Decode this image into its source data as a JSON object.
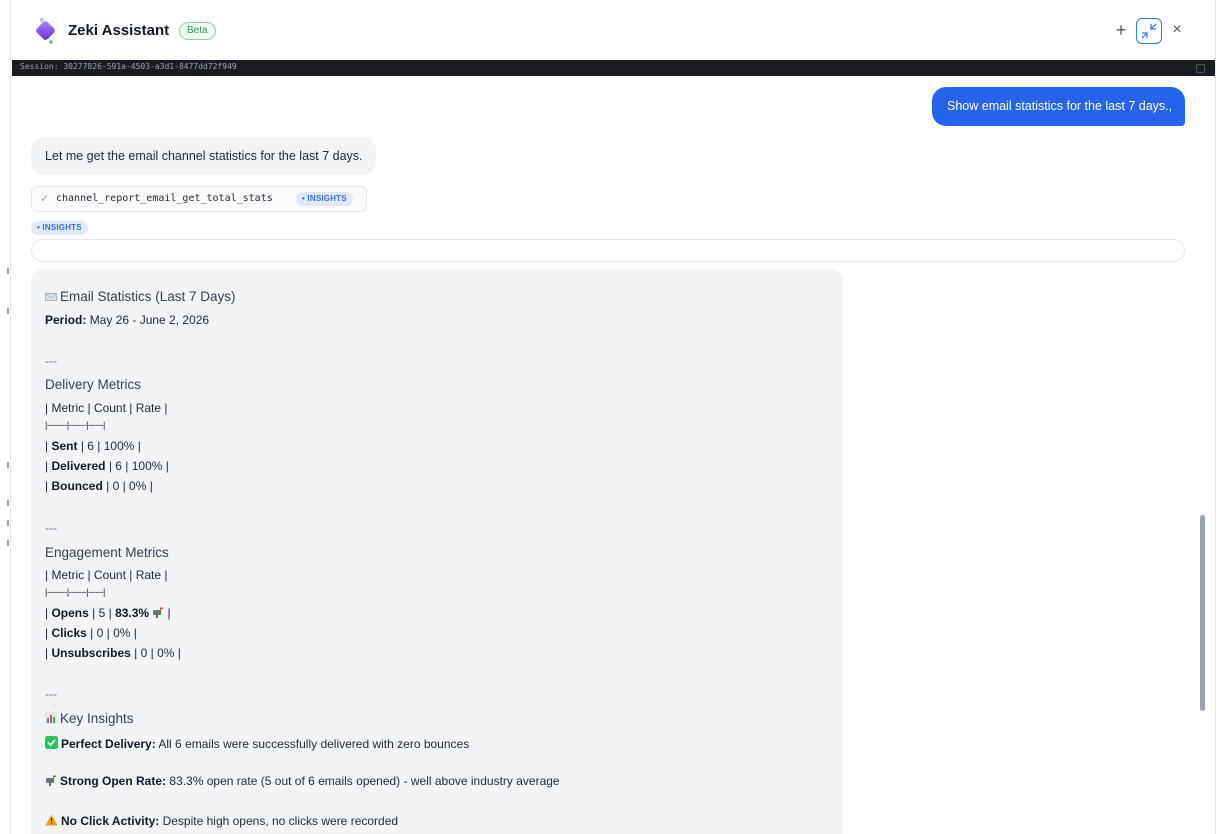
{
  "header": {
    "title": "Zeki Assistant",
    "badge": "Beta",
    "plus_label": "+",
    "close_label": "×"
  },
  "session": {
    "text": "Session: 30277826-591a-4503-a3d1-8477dd72f949"
  },
  "messages": {
    "user": "Show email statistics for the last 7 days.,",
    "assistant_intro": "Let me get the email channel statistics for the last 7 days.",
    "tool_call": {
      "name": "channel_report_email_get_total_stats",
      "tag": "• INSIGHTS"
    },
    "insights_tag": "• INSIGHTS"
  },
  "report": {
    "title": "Email Statistics (Last 7 Days)",
    "period_label": "Period:",
    "period_value": "May 26 - June 2, 2026",
    "hr1": "---",
    "delivery_heading": "Delivery Metrics",
    "delivery_header": "| Metric | Count | Rate |",
    "delivery_divider": "|--------|-------|------|",
    "delivery_rows": [
      {
        "label": "Sent",
        "rest": "| 6 | 100% |"
      },
      {
        "label": "Delivered",
        "rest": "| 6 | 100% |"
      },
      {
        "label": "Bounced",
        "rest": "| 0 | 0% |"
      }
    ],
    "hr2": "---",
    "engagement_heading": "Engagement Metrics",
    "engagement_header": "| Metric | Count | Rate |",
    "engagement_divider": "|--------|-------|------|",
    "engagement_rows": [
      {
        "label": "Opens",
        "rest": "| 5 |",
        "rate": "83.3%",
        "tail": "|"
      },
      {
        "label": "Clicks",
        "rest": "| 0 | 0% |"
      },
      {
        "label": "Unsubscribes",
        "rest": "| 0 | 0% |"
      }
    ],
    "hr3": "---",
    "insights_heading": "Key Insights",
    "insights": [
      {
        "label": "Perfect Delivery:",
        "text": "All 6 emails were successfully delivered with zero bounces"
      },
      {
        "label": "Strong Open Rate:",
        "text": "83.3% open rate (5 out of 6 emails opened) - well above industry average"
      },
      {
        "label": "No Click Activity:",
        "text": "Despite high opens, no clicks were recorded"
      }
    ]
  },
  "colors": {
    "accent": "#2563eb",
    "beta_green": "#22a058",
    "pill_blue": "#3b6fd9"
  },
  "icons": [
    "assistant-logo-icon",
    "plus-icon",
    "shrink-icon",
    "close-icon",
    "copy-icon",
    "check-icon",
    "envelope-icon",
    "mailbox-icon",
    "bar-chart-icon",
    "checkmark-box-icon",
    "warning-icon"
  ]
}
